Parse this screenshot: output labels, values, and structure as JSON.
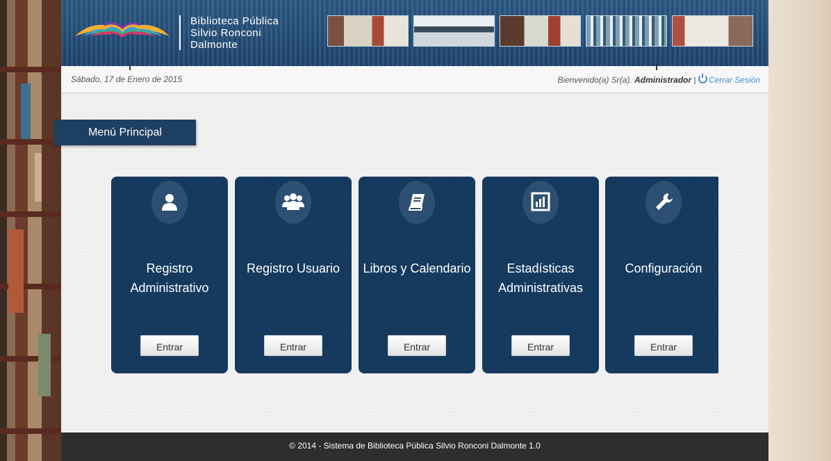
{
  "header": {
    "site_name_line1": "Biblioteca Pública",
    "site_name_line2": "Silvio Ronconi",
    "site_name_line3": "Dalmonte"
  },
  "infobar": {
    "date": "Sábado, 17 de Enero de 2015",
    "welcome_prefix": "Bienvenido(a) Sr(a).",
    "user_role": "Administrador",
    "separator": "|",
    "logout_label": "Cerrar Sesión"
  },
  "menu": {
    "label": "Menú Principal"
  },
  "cards": [
    {
      "title_line1": "Registro",
      "title_line2": "Administrativo",
      "button": "Entrar",
      "icon": "user-icon"
    },
    {
      "title_line1": "Registro Usuario",
      "title_line2": "",
      "button": "Entrar",
      "icon": "users-icon"
    },
    {
      "title_line1": "Libros y Calendario",
      "title_line2": "",
      "button": "Entrar",
      "icon": "book-icon"
    },
    {
      "title_line1": "Estadísticas",
      "title_line2": "Administrativas",
      "button": "Entrar",
      "icon": "bar-chart-icon"
    },
    {
      "title_line1": "Configuración",
      "title_line2": "",
      "button": "Entrar",
      "icon": "wrench-icon"
    }
  ],
  "footer": {
    "text": "© 2014 - Sistema de Biblioteca Pública Silvio Ronconi Dalmonte 1.0"
  },
  "colors": {
    "header": "#1f4770",
    "card": "#153a5e",
    "menu_label": "#1d3f61",
    "footer": "#2e2e2e",
    "link": "#4a8fd0"
  }
}
